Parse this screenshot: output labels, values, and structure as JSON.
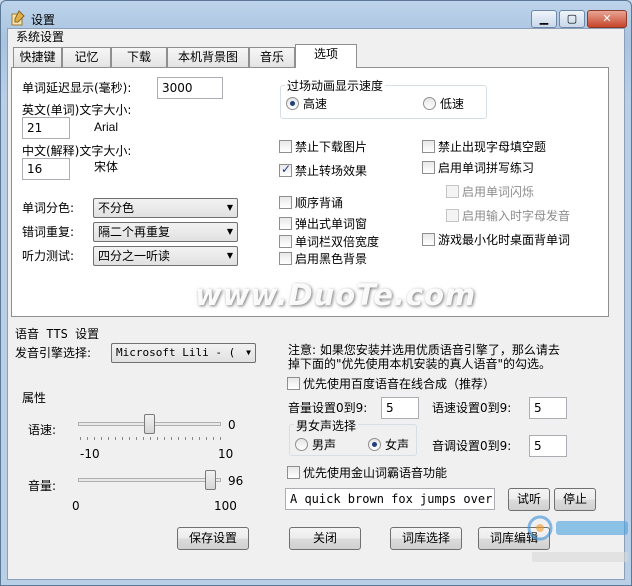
{
  "window": {
    "title": "设置",
    "section_label": "系统设置"
  },
  "tabs": [
    {
      "label": "快捷键"
    },
    {
      "label": "记忆"
    },
    {
      "label": "下载"
    },
    {
      "label": "本机背景图"
    },
    {
      "label": "音乐"
    },
    {
      "label": "选项",
      "active": true
    }
  ],
  "options": {
    "delay_label": "单词延迟显示(毫秒):",
    "delay_value": "3000",
    "en_size_label": "英文(单词)文字大小:",
    "en_size_value": "21",
    "en_font": "Arial",
    "cn_size_label": "中文(解释)文字大小:",
    "cn_size_value": "16",
    "cn_font": "宋体",
    "color_label": "单词分色:",
    "color_value": "不分色",
    "repeat_label": "错词重复:",
    "repeat_value": "隔二个再重复",
    "listen_label": "听力测试:",
    "listen_value": "四分之一听读",
    "speed_group": "过场动画显示速度",
    "speed_fast": "高速",
    "speed_slow": "低速",
    "checks": {
      "no_download_img": "禁止下载图片",
      "no_transition": "禁止转场效果",
      "sequential": "顺序背诵",
      "popup": "弹出式单词窗",
      "double_width": "单词栏双倍宽度",
      "dark_bg": "启用黑色背景",
      "no_blank": "禁止出现字母填空题",
      "spell": "启用单词拼写练习",
      "flash": "启用单词闪烁",
      "letter_sound": "启用输入时字母发音",
      "minimized": "游戏最小化时桌面背单词"
    }
  },
  "tts": {
    "section_label": "语音 TTS 设置",
    "engine_label": "发音引擎选择:",
    "engine_value": "Microsoft Lili - (",
    "note": "注意: 如果您安装并选用优质语音引擎了，那么请去掉下面的\"优先使用本机安装的真人语音\"的勾选。",
    "note_line1": "注意: 如果您安装并选用优质语音引擎了，那么请去",
    "note_line2": "掉下面的\"优先使用本机安装的真人语音\"的勾选。",
    "baidu_label": "优先使用百度语音在线合成（推荐）",
    "volume_label": "音量设置0到9:",
    "volume_value": "5",
    "speed_label": "语速设置0到9:",
    "speed_value": "5",
    "gender_group": "男女声选择",
    "male": "男声",
    "female": "女声",
    "pitch_label": "音调设置0到9:",
    "pitch_value": "5",
    "jinshan_label": "优先使用金山词霸语音功能",
    "sample_text": "A quick brown fox jumps over",
    "listen_button": "试听",
    "stop_button": "停止",
    "props_label": "属性",
    "rate_label": "语速:",
    "rate_value": "0",
    "rate_min": "-10",
    "rate_max": "10",
    "rate_level": 0,
    "vol_label": "音量:",
    "vol_value": "96",
    "vol_min": "0",
    "vol_max": "100",
    "vol_level": 96
  },
  "buttons": {
    "save": "保存设置",
    "close": "关闭",
    "lib_select": "词库选择",
    "lib_edit": "词库编辑"
  },
  "watermark": {
    "text": "www.DuoTe.com"
  }
}
